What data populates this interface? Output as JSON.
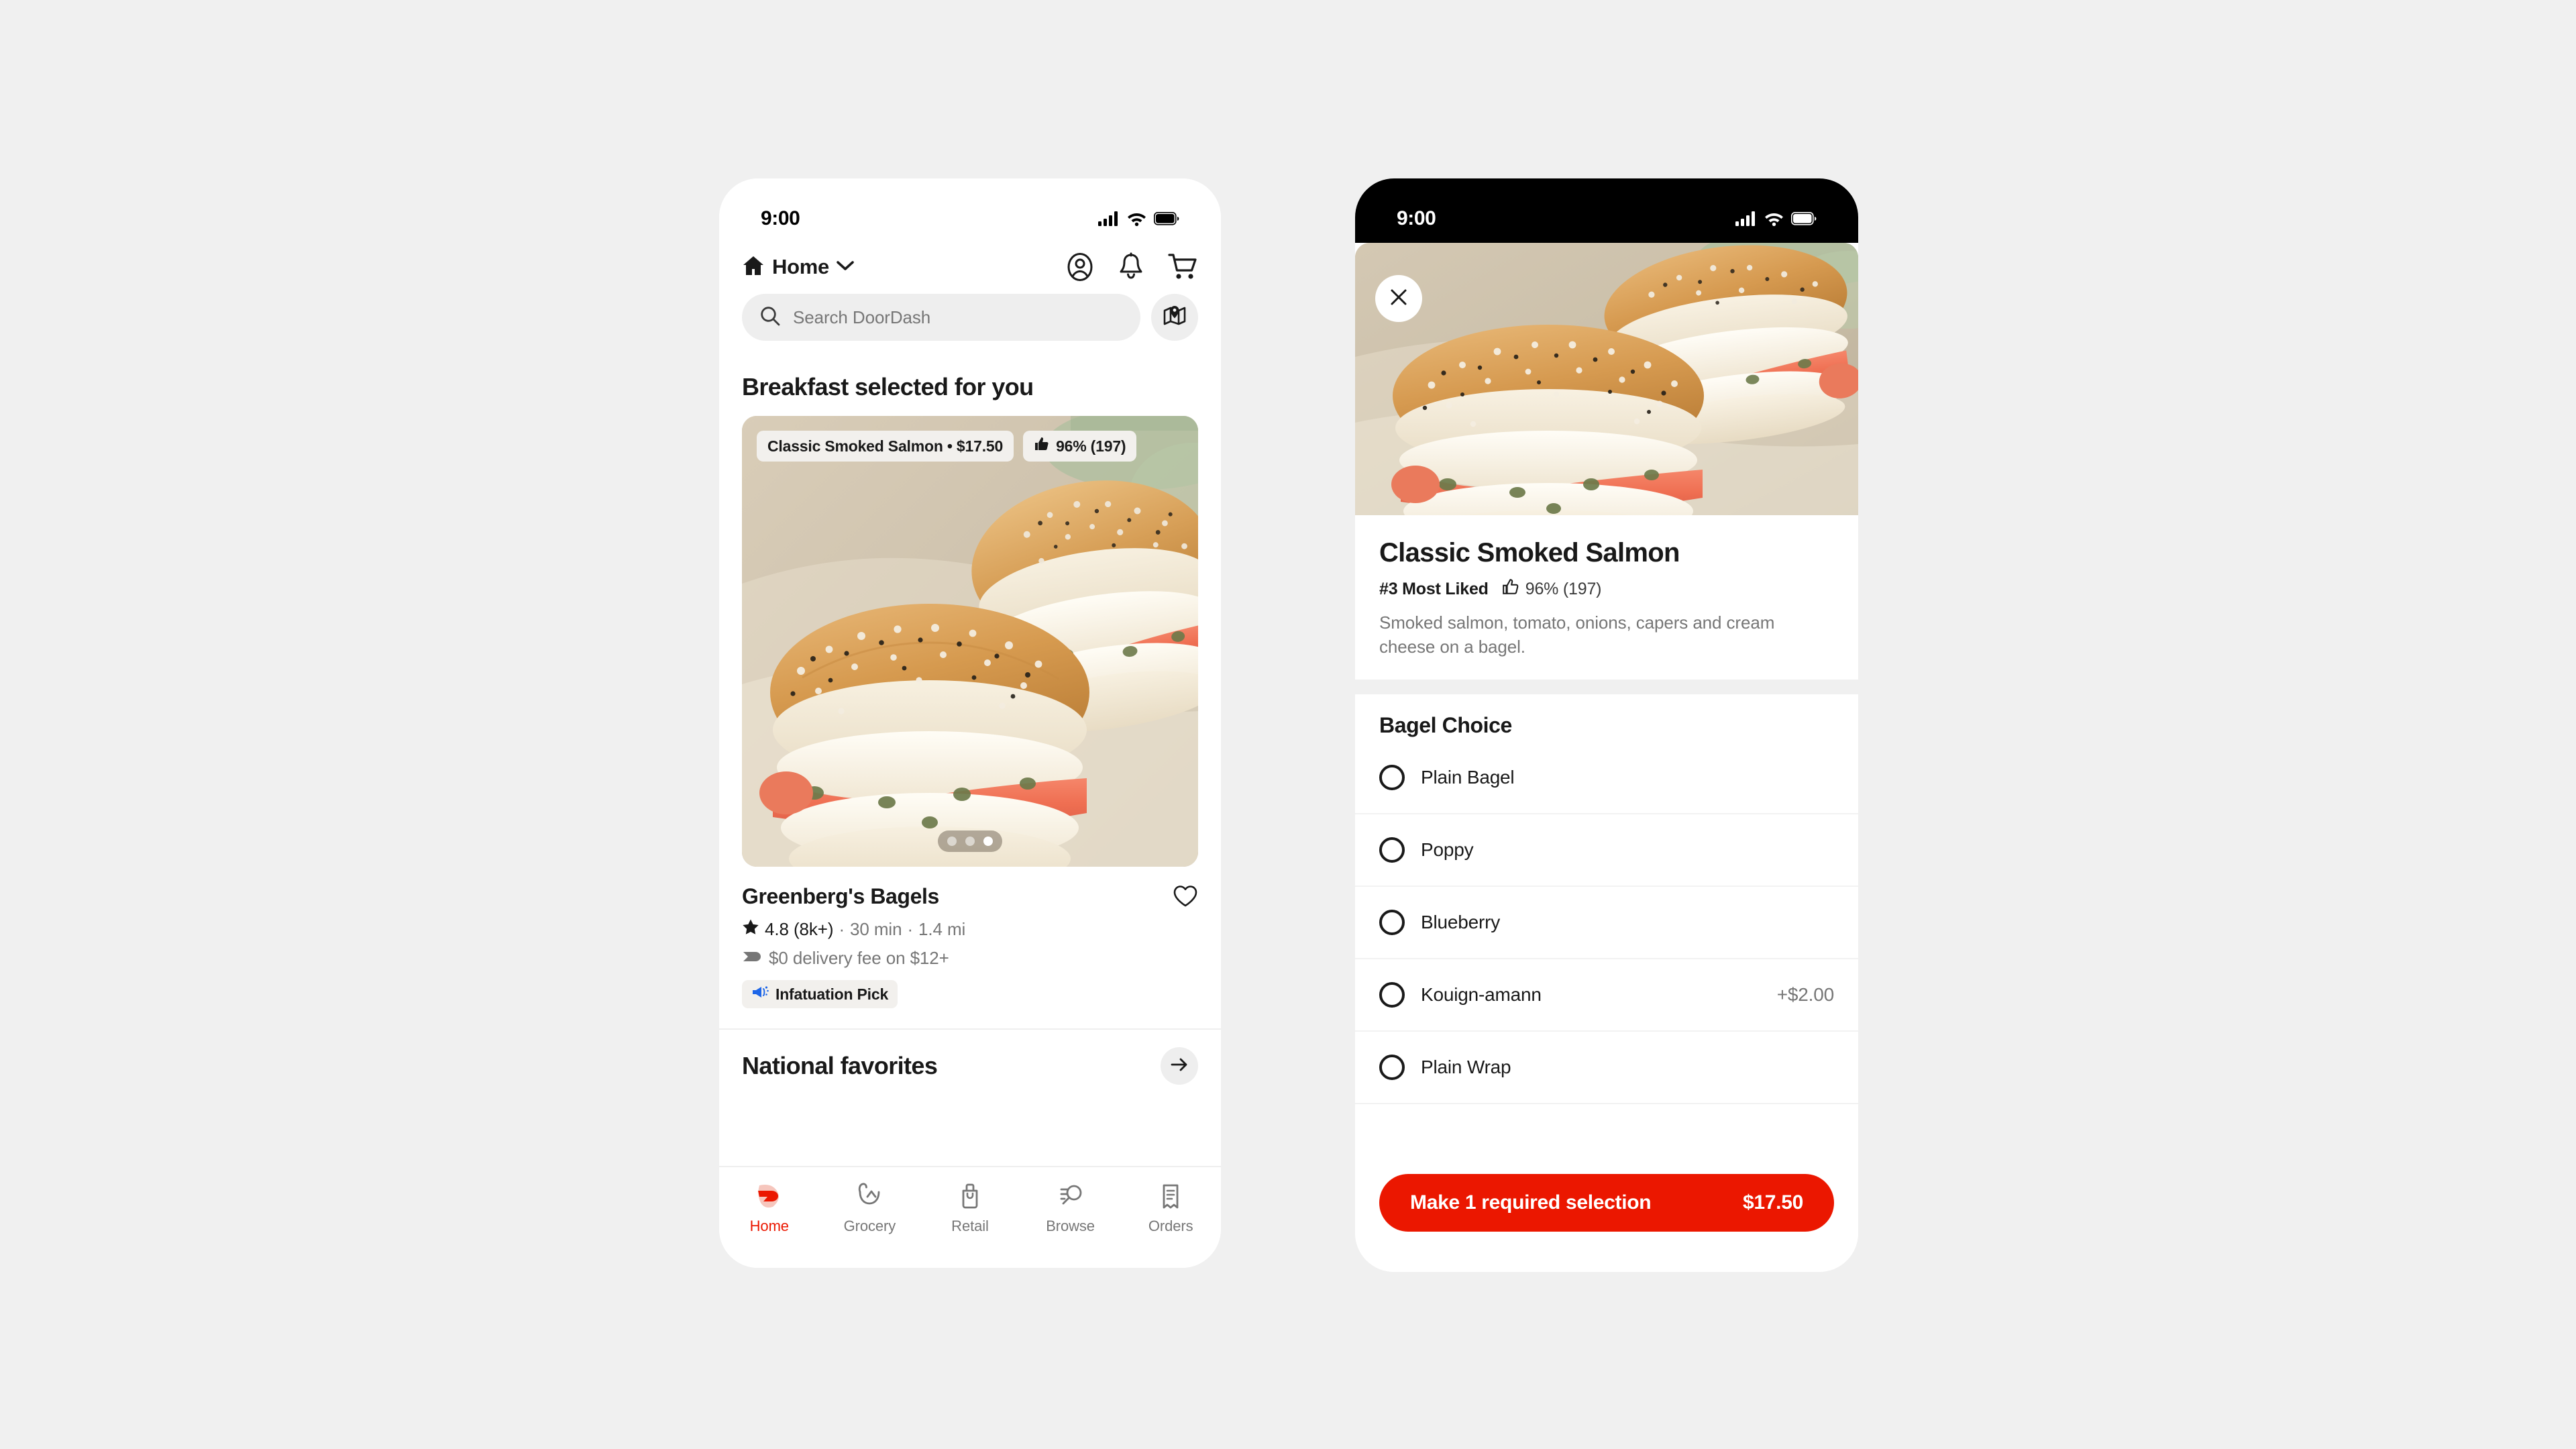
{
  "status_bar": {
    "time": "9:00",
    "cellular_icon": "cellular-signal-icon",
    "wifi_icon": "wifi-icon",
    "battery_icon": "battery-icon"
  },
  "left_screen": {
    "header": {
      "home_icon": "home-icon",
      "location_label": "Home",
      "chevron_icon": "chevron-down-icon",
      "account_icon": "account-circle-icon",
      "notifications_icon": "bell-icon",
      "cart_icon": "shopping-cart-icon"
    },
    "search": {
      "search_icon": "search-icon",
      "placeholder": "Search DoorDash",
      "value": "",
      "map_icon": "map-pin-icon"
    },
    "feed": {
      "section_title": "Breakfast selected for you",
      "card": {
        "item_badge": "Classic Smoked Salmon • $17.50",
        "rating_badge": "96% (197)",
        "thumbs_up_icon": "thumbs-up-icon",
        "carousel_dots": 3,
        "carousel_active_index": 2,
        "store_name": "Greenberg's Bagels",
        "favorite_icon": "heart-outline-icon",
        "star_icon": "star-icon",
        "rating": "4.8 (8k+)",
        "delivery_time": "30 min",
        "distance": "1.4 mi",
        "fee_icon": "delivery-tag-icon",
        "fee_text": "$0 delivery fee on $12+",
        "promo_badge": "Infatuation Pick",
        "promo_icon": "megaphone-icon"
      },
      "next_section_title": "National favorites",
      "next_section_arrow_icon": "arrow-right-icon"
    },
    "tabbar": [
      {
        "label": "Home",
        "icon": "doordash-logo-icon",
        "active": true
      },
      {
        "label": "Grocery",
        "icon": "grocery-basket-icon",
        "active": false
      },
      {
        "label": "Retail",
        "icon": "retail-bag-icon",
        "active": false
      },
      {
        "label": "Browse",
        "icon": "browse-search-icon",
        "active": false
      },
      {
        "label": "Orders",
        "icon": "orders-receipt-icon",
        "active": false
      }
    ]
  },
  "right_screen": {
    "close_icon": "close-x-icon",
    "item": {
      "title": "Classic Smoked Salmon",
      "rank": "#3 Most Liked",
      "thumbs_up_icon": "thumbs-up-icon",
      "likes": "96% (197)",
      "description": "Smoked salmon, tomato, onions, capers and cream cheese on a bagel."
    },
    "option_group": {
      "title": "Bagel Choice",
      "options": [
        {
          "label": "Plain Bagel",
          "price": "",
          "selected": false
        },
        {
          "label": "Poppy",
          "price": "",
          "selected": false
        },
        {
          "label": "Blueberry",
          "price": "",
          "selected": false
        },
        {
          "label": "Kouign-amann",
          "price": "+$2.00",
          "selected": false
        },
        {
          "label": "Plain Wrap",
          "price": "",
          "selected": false
        }
      ]
    },
    "cta": {
      "label": "Make 1 required selection",
      "price": "$17.50"
    }
  },
  "colors": {
    "brand_red": "#eb1700",
    "page_background": "#f0f0f0",
    "text_primary": "#191919",
    "text_secondary": "#767676",
    "field_background": "#eeeeee",
    "promo_blue": "#1e66e8"
  }
}
